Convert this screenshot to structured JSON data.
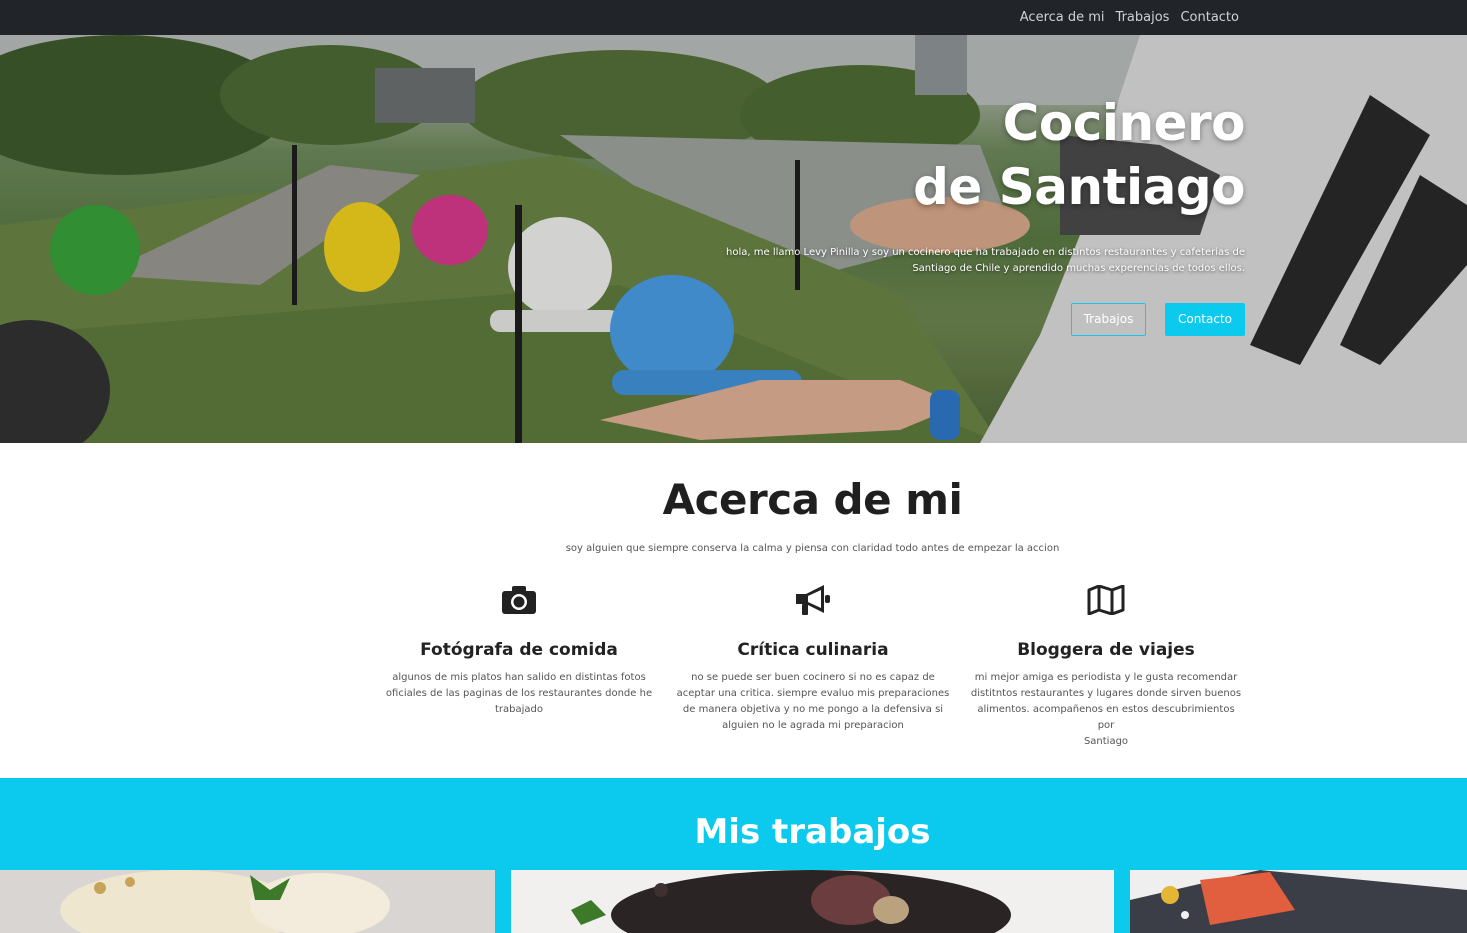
{
  "nav": {
    "links": [
      "Acerca de mi",
      "Trabajos",
      "Contacto"
    ]
  },
  "hero": {
    "title_line1": "Cocinero",
    "title_line2": "de Santiago",
    "text_line1": "hola, me llamo Levy Pinilla y soy un cocinero que ha trabajado en distintos restaurantes y cafeterias de",
    "text_line2": "Santiago de Chile y aprendido muchas experencias de todos ellos.",
    "btn_works": "Trabajos",
    "btn_contact": "Contacto"
  },
  "about": {
    "title": "Acerca de mi",
    "subtitle": "soy alguien que siempre conserva la calma y piensa con claridad todo antes de empezar la accion",
    "features": [
      {
        "icon": "camera-icon",
        "title": "Fotógrafa de comida",
        "lines": [
          "algunos de mis platos han salido en distintas fotos",
          "oficiales de las paginas de los restaurantes donde he",
          "trabajado"
        ]
      },
      {
        "icon": "megaphone-icon",
        "title": "Crítica culinaria",
        "lines": [
          "no se puede ser buen cocinero si no es capaz de",
          "aceptar una critica. siempre evaluo mis preparaciones",
          "de manera objetiva y no me pongo a la defensiva si",
          "alguien no le agrada mi preparacion"
        ]
      },
      {
        "icon": "map-icon",
        "title": "Bloggera de viajes",
        "lines": [
          "mi mejor amiga es periodista y le gusta recomendar",
          "distitntos restaurantes y lugares donde sirven buenos",
          "alimentos. acompañenos en estos descubrimientos por",
          "Santiago"
        ]
      }
    ]
  },
  "works": {
    "title": "Mis trabajos"
  },
  "colors": {
    "accent": "#0ccaee",
    "navbar": "#212529"
  }
}
